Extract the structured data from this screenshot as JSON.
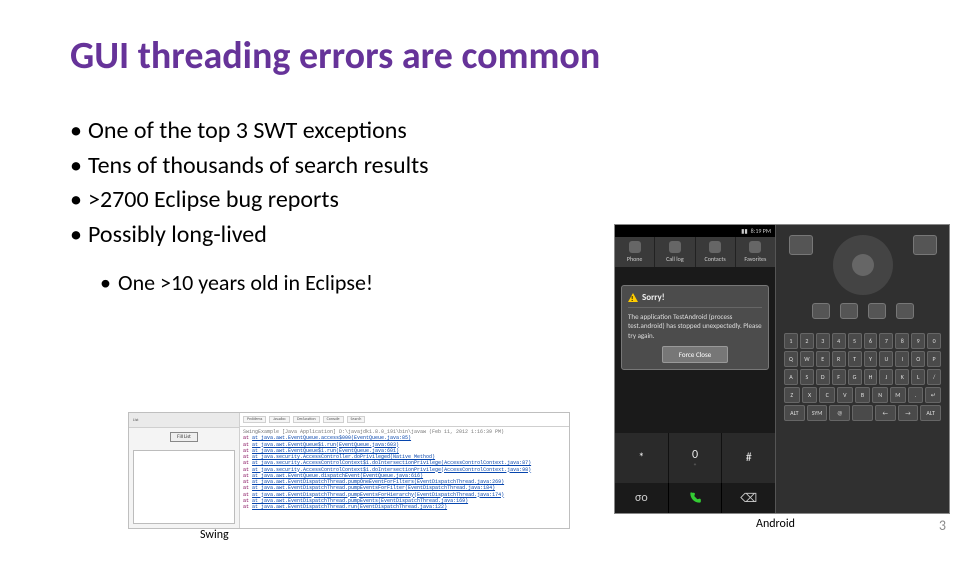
{
  "title": "GUI threading errors are common",
  "bullets": [
    "One of the top 3 SWT exceptions",
    "Tens of thousands of search results",
    ">2700 Eclipse bug reports",
    "Possibly long-lived"
  ],
  "sub_bullets": [
    "One >10 years old in Eclipse!"
  ],
  "swing": {
    "caption": "Swing",
    "toolbar_label": "List",
    "button": "Fill List",
    "tabs": [
      "Problems",
      "Javadoc",
      "Declaration",
      "Console",
      "Search"
    ],
    "console_title": "SwingExample [Java Application] D:\\javajdk1.8.0_191\\bin\\javaw (Feb 11, 2012 1:16:39 PM)",
    "stack": [
      "at java.awt.EventQueue.access$000(EventQueue.java:85)",
      "at java.awt.EventQueue$1.run(EventQueue.java:603)",
      "at java.awt.EventQueue$1.run(EventQueue.java:601)",
      "at java.security.AccessController.doPrivileged(Native Method)",
      "at java.security.AccessControlContext$1.doIntersectionPrivilege(AccessControlContext.java:87)",
      "at java.security.AccessControlContext$1.doIntersectionPrivilege(AccessControlContext.java:98)",
      "at java.awt.EventQueue.dispatchEvent(EventQueue.java:616)",
      "at java.awt.EventDispatchThread.pumpOneEventForFilters(EventDispatchThread.java:269)",
      "at java.awt.EventDispatchThread.pumpEventsForFilter(EventDispatchThread.java:184)",
      "at java.awt.EventDispatchThread.pumpEventsForHierarchy(EventDispatchThread.java:174)",
      "at java.awt.EventDispatchThread.pumpEvents(EventDispatchThread.java:169)",
      "at java.awt.EventDispatchThread.run(EventDispatchThread.java:122)"
    ]
  },
  "android": {
    "caption": "Android",
    "status_time": "8:19 PM",
    "tabs": [
      "Phone",
      "Call log",
      "Contacts",
      "Favorites"
    ],
    "dialog_title": "Sorry!",
    "dialog_body": "The application TestAndroid (process test.android) has stopped unexpectedly. Please try again.",
    "dialog_button": "Force Close",
    "dial_keys": [
      {
        "main": "*",
        "sub": ""
      },
      {
        "main": "0",
        "sub": "+"
      },
      {
        "main": "#",
        "sub": ""
      }
    ],
    "kbd_rows": [
      [
        "1",
        "2",
        "3",
        "4",
        "5",
        "6",
        "7",
        "8",
        "9",
        "0"
      ],
      [
        "Q",
        "W",
        "E",
        "R",
        "T",
        "Y",
        "U",
        "I",
        "O",
        "P"
      ],
      [
        "A",
        "S",
        "D",
        "F",
        "G",
        "H",
        "J",
        "K",
        "L",
        "/"
      ],
      [
        "Z",
        "X",
        "C",
        "V",
        "B",
        "N",
        "M",
        ".",
        "↵"
      ],
      [
        "ALT",
        "SYM",
        "@",
        " ",
        "←",
        "→",
        "ALT"
      ]
    ]
  },
  "page_number": "3"
}
